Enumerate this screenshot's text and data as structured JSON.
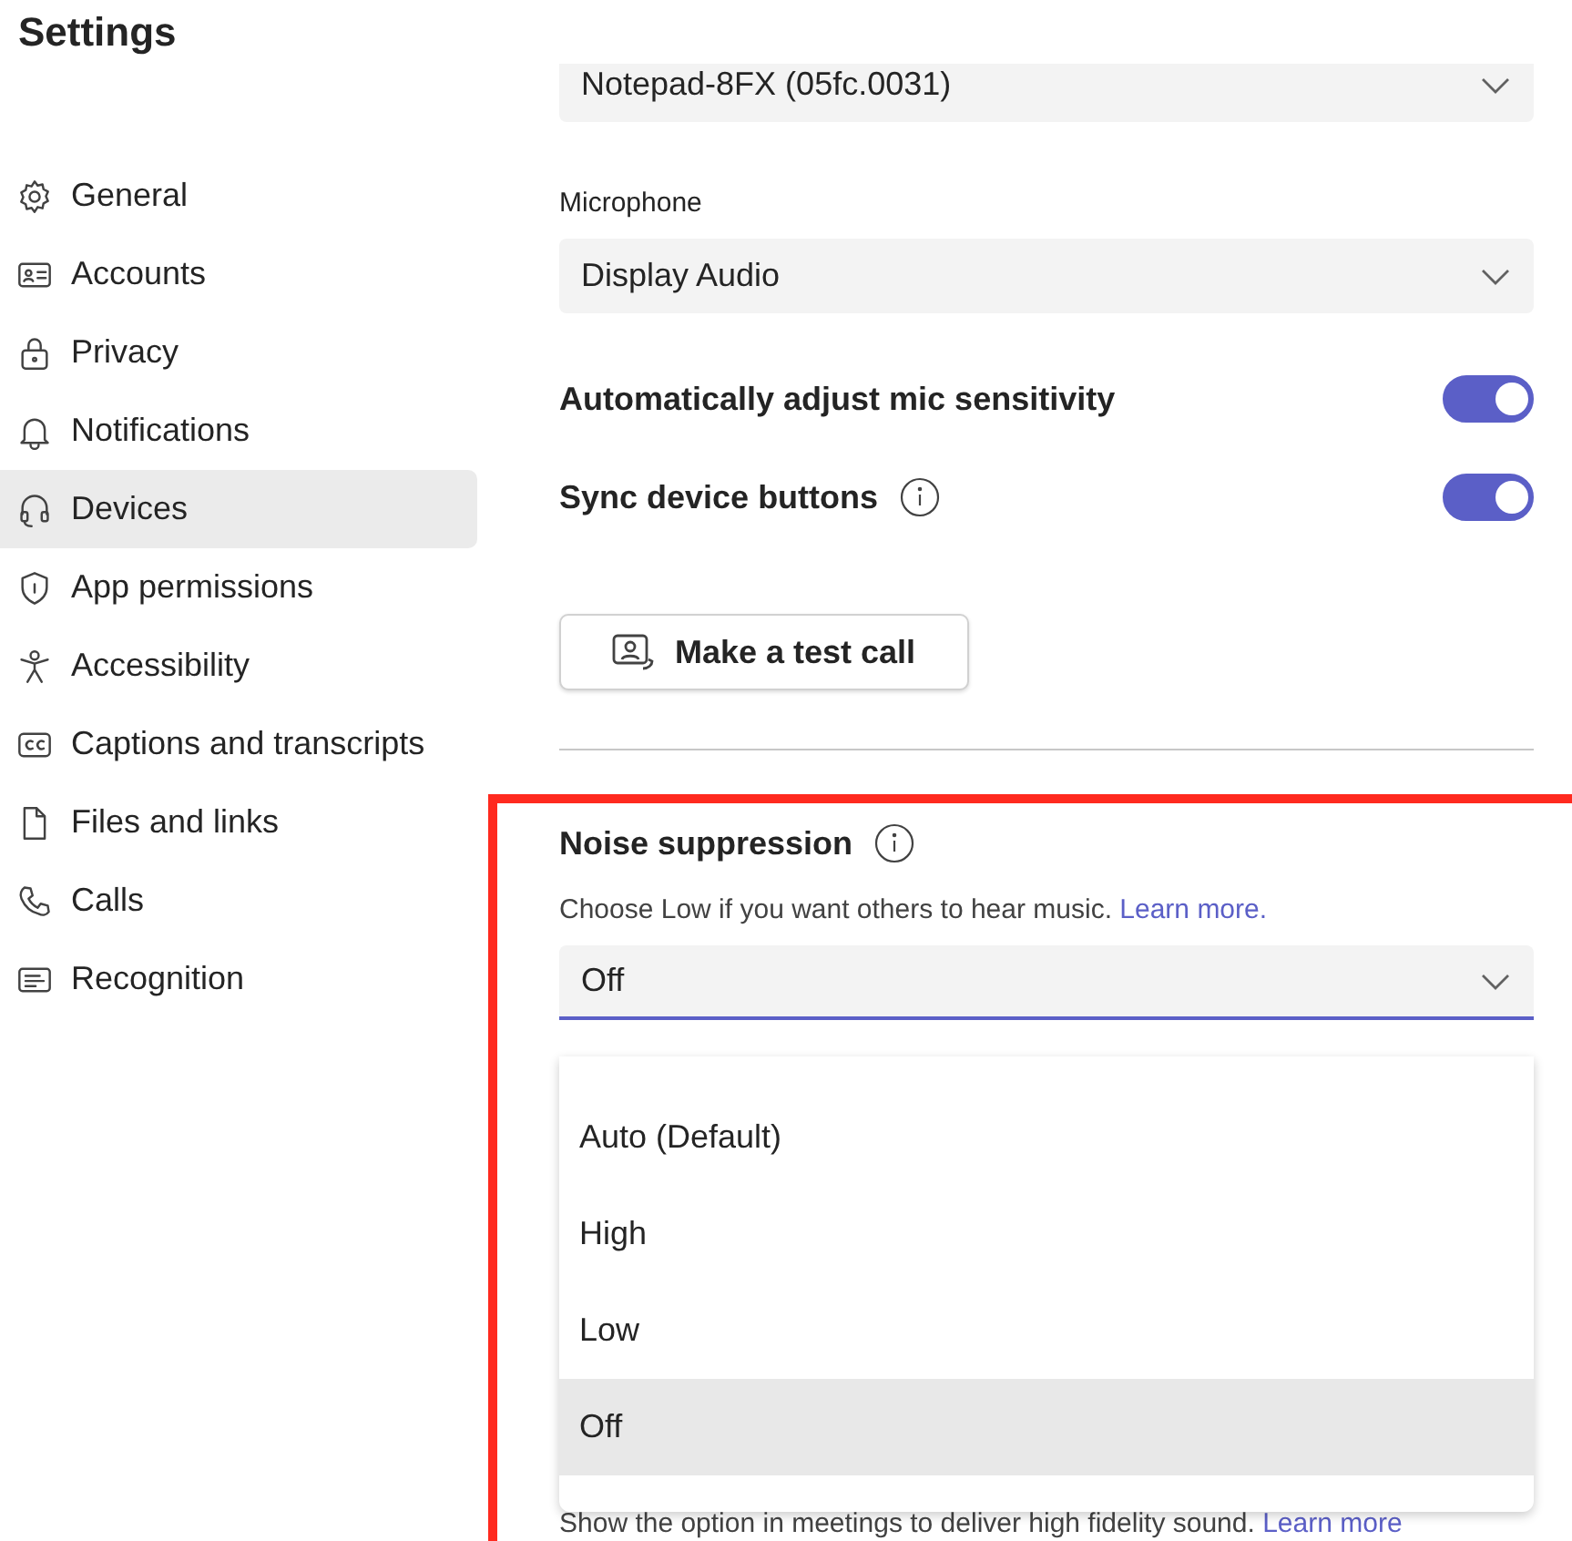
{
  "title": "Settings",
  "sidebar": {
    "items": [
      {
        "label": "General",
        "selected": false
      },
      {
        "label": "Accounts",
        "selected": false
      },
      {
        "label": "Privacy",
        "selected": false
      },
      {
        "label": "Notifications",
        "selected": false
      },
      {
        "label": "Devices",
        "selected": true
      },
      {
        "label": "App permissions",
        "selected": false
      },
      {
        "label": "Accessibility",
        "selected": false
      },
      {
        "label": "Captions and transcripts",
        "selected": false
      },
      {
        "label": "Files and links",
        "selected": false
      },
      {
        "label": "Calls",
        "selected": false
      },
      {
        "label": "Recognition",
        "selected": false
      }
    ]
  },
  "speaker_select": {
    "value": "Notepad-8FX (05fc.0031)"
  },
  "microphone": {
    "label": "Microphone",
    "value": "Display Audio"
  },
  "toggles": [
    {
      "label": "Automatically adjust mic sensitivity",
      "info": false,
      "on": true
    },
    {
      "label": "Sync device buttons",
      "info": true,
      "on": true
    }
  ],
  "test_call_button": "Make a test call",
  "noise_suppression": {
    "title": "Noise suppression",
    "description": "Choose Low if you want others to hear music.",
    "link": "Learn more.",
    "value": "Off",
    "expanded": true,
    "options": [
      {
        "label": "Auto (Default)",
        "selected": false
      },
      {
        "label": "High",
        "selected": false
      },
      {
        "label": "Low",
        "selected": false
      },
      {
        "label": "Off",
        "selected": true
      }
    ]
  },
  "hifi_note": {
    "text": "Show the option in meetings to deliver high fidelity sound.",
    "link": "Learn more"
  }
}
